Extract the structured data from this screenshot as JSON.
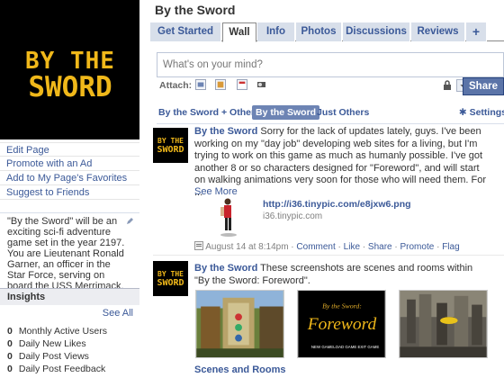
{
  "page": {
    "title": "By the Sword"
  },
  "profile": {
    "logo_line1": "BY THE",
    "logo_line2": "SWORD",
    "links": [
      "Edit Page",
      "Promote with an Ad",
      "Add to My Page's Favorites",
      "Suggest to Friends"
    ],
    "bio": "\"By the Sword\" will be an exciting sci-fi adventure game set in the year 2197. You are Lieutenant Ronald Garner, an officer in the Star Force, serving on board the USS Merrimack."
  },
  "insights": {
    "title": "Insights",
    "see_all": "See All",
    "rows": [
      {
        "count": "0",
        "label": "Monthly Active Users"
      },
      {
        "count": "0",
        "label": "Daily New Likes"
      },
      {
        "count": "0",
        "label": "Daily Post Views"
      },
      {
        "count": "0",
        "label": "Daily Post Feedback"
      }
    ]
  },
  "tabs": [
    {
      "label": "Get Started"
    },
    {
      "label": "Wall",
      "active": true
    },
    {
      "label": "Info"
    },
    {
      "label": "Photos"
    },
    {
      "label": "Discussions"
    },
    {
      "label": "Reviews"
    },
    {
      "label": "+"
    }
  ],
  "composer": {
    "placeholder": "What's on your mind?",
    "attach_label": "Attach:",
    "attach_icons": [
      "photo-icon",
      "video-icon",
      "event-icon",
      "link-icon"
    ],
    "share_label": "Share"
  },
  "filters": {
    "items": [
      "By the Sword + Others",
      "By the Sword",
      "Just Others"
    ],
    "active_index": 1,
    "settings_label": "Settings"
  },
  "posts": [
    {
      "actor": "By the Sword",
      "text": "Sorry for the lack of updates lately, guys. I've been working on my \"day job\" developing web sites for a living, but I'm trying to work on this game as much as humanly possible. I've got another 8 or so characters designed for \"Foreword\", and will start on walking animations very soon for those who will need them. For ...",
      "see_more": "See More",
      "attachment": {
        "link": "http://i36.tinypic.com/e8jxw6.png",
        "host": "i36.tinypic.com"
      },
      "meta": {
        "time": "August 14 at 8:14pm",
        "actions": [
          "Comment",
          "Like",
          "Share",
          "Promote",
          "Flag"
        ]
      }
    },
    {
      "actor": "By the Sword",
      "text": "These screenshots are scenes and rooms within \"By the Sword: Foreword\".",
      "screenshots": [
        {
          "subject": "game-room-scene"
        },
        {
          "subject": "foreword-title-screen",
          "title_small": "By the Sword:",
          "title_big": "Foreword",
          "menu": [
            "NEW GAME",
            "LOAD GAME",
            "EXIT GAME"
          ]
        },
        {
          "subject": "city-flyer-scene"
        }
      ],
      "album_link": "Scenes and Rooms"
    }
  ],
  "colors": {
    "fb_blue": "#3b5998",
    "tab_bg": "#d8dfea",
    "logo_gold": "#f0b81a",
    "share_bg": "#5b74a8"
  }
}
